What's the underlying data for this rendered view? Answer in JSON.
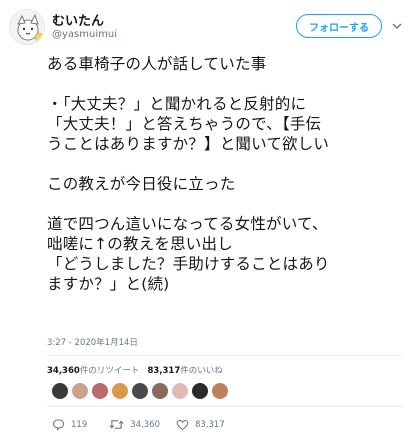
{
  "user": {
    "display_name": "むいたん",
    "handle": "@yasmuimui"
  },
  "follow_label": "フォローする",
  "tweet": {
    "lines": [
      "ある車椅子の人が話していた事",
      "",
      "・「大丈夫？」と聞かれると反射的に",
      "「大丈夫！」と答えちゃうので、【手伝",
      "うことはありますか？】と聞いて欲しい",
      "",
      "この教えが今日役に立った",
      "",
      "道で四つん這いになってる女性がいて、",
      "咄嗟に↑の教えを思い出し",
      "「どうしました？手助けすることはあり",
      "ますか？」と(続)"
    ],
    "timestamp": "3:27 - 2020年1月14日"
  },
  "stats": {
    "retweets_count": "34,360",
    "retweets_label": "件のリツイート",
    "likes_count": "83,317",
    "likes_label": "件のいいね"
  },
  "likers": [
    "#3a3a3a",
    "#c9a38a",
    "#b86b6b",
    "#d89a4a",
    "#4a4a4a",
    "#8a6a5a",
    "#e0b8b8",
    "#2a2a2a",
    "#c08060"
  ],
  "actions": {
    "reply_count": "119",
    "retweet_count": "34,360",
    "like_count": "83,317"
  },
  "colors": {
    "accent": "#1da1f2",
    "text": "#14171a",
    "muted": "#657786"
  },
  "icons": [
    "avatar",
    "chevron-down-icon",
    "reply-icon",
    "retweet-icon",
    "heart-icon"
  ]
}
